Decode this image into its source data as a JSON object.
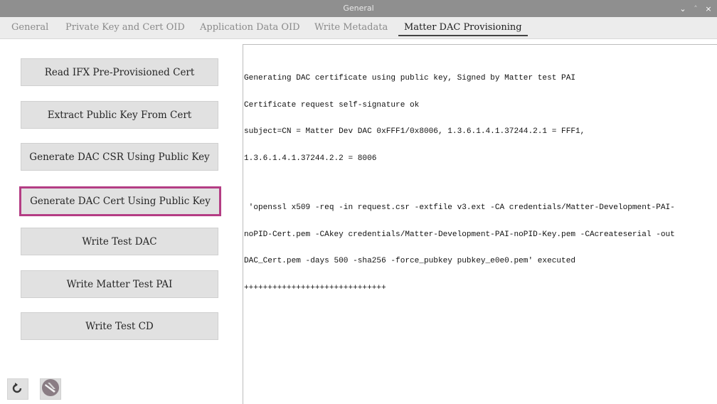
{
  "window": {
    "title": "General",
    "controls": {
      "minimize": "⌄",
      "maximize": "˄",
      "close": "×"
    }
  },
  "tabs": [
    {
      "label": "General"
    },
    {
      "label": "Private Key and Cert OID"
    },
    {
      "label": "Application Data OID"
    },
    {
      "label": "Write Metadata"
    },
    {
      "label": "Matter DAC Provisioning",
      "active": true
    }
  ],
  "buttons": [
    {
      "label": "Read IFX Pre-Provisioned Cert"
    },
    {
      "label": "Extract Public Key From Cert"
    },
    {
      "label": "Generate DAC CSR Using Public Key"
    },
    {
      "label": "Generate DAC Cert Using Public Key",
      "highlighted": true
    },
    {
      "label": "Write Test DAC"
    },
    {
      "label": "Write Matter Test PAI"
    },
    {
      "label": "Write Test CD"
    }
  ],
  "console": {
    "lines": [
      "Generating DAC certificate using public key, Signed by Matter test PAI",
      "Certificate request self-signature ok",
      "subject=CN = Matter Dev DAC 0xFFF1/0x8006, 1.3.6.1.4.1.37244.2.1 = FFF1,",
      "1.3.6.1.4.1.37244.2.2 = 8006",
      "",
      " 'openssl x509 -req -in request.csr -extfile v3.ext -CA credentials/Matter-Development-PAI-",
      "noPID-Cert.pem -CAkey credentials/Matter-Development-PAI-noPID-Key.pem -CAcreateserial -out",
      "DAC_Cert.pem -days 500 -sha256 -force_pubkey pubkey_e0e0.pem' executed",
      "++++++++++++++++++++++++++++++"
    ]
  },
  "bottom_icons": [
    {
      "icon": "reset-icon"
    },
    {
      "icon": "theme-toggle-icon"
    }
  ],
  "colors": {
    "titlebar": "#8f8f8f",
    "highlight_border": "#b43d84",
    "button_bg": "#e1e1e1"
  }
}
